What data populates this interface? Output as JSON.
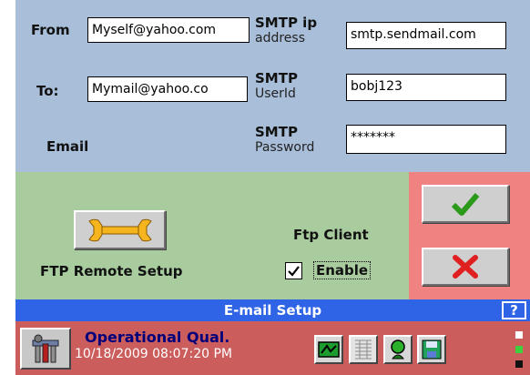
{
  "form": {
    "from_label": "From",
    "from_value": "Myself@yahoo.com",
    "to_label": "To:",
    "to_value": "Mymail@yahoo.co",
    "email_label": "Email",
    "smtp_ip_label_line1": "SMTP ip",
    "smtp_ip_label_line2": "address",
    "smtp_ip_value": "smtp.sendmail.com",
    "smtp_user_label_line1": "SMTP",
    "smtp_user_label_line2": "UserId",
    "smtp_user_value": "bobj123",
    "smtp_pass_label_line1": "SMTP",
    "smtp_pass_label_line2": "Password",
    "smtp_pass_value": "*******"
  },
  "ftp": {
    "remote_setup_label": "FTP Remote Setup",
    "client_label": "Ftp Client",
    "enable_label": "Enable",
    "enable_checked": true
  },
  "title_bar": {
    "title": "E-mail Setup",
    "help_label": "?"
  },
  "status_bar": {
    "mode": "Operational Qual.",
    "timestamp": "10/18/2009 08:07:20 PM"
  },
  "icons": {
    "wrench": "wrench-icon",
    "ok": "check-icon",
    "cancel": "x-icon"
  },
  "colors": {
    "top_panel": "#a9bfd9",
    "ftp_panel": "#a9cc9f",
    "action_panel": "#f08282",
    "title_bar": "#2f64e6",
    "status_bar": "#cc5d5d"
  }
}
